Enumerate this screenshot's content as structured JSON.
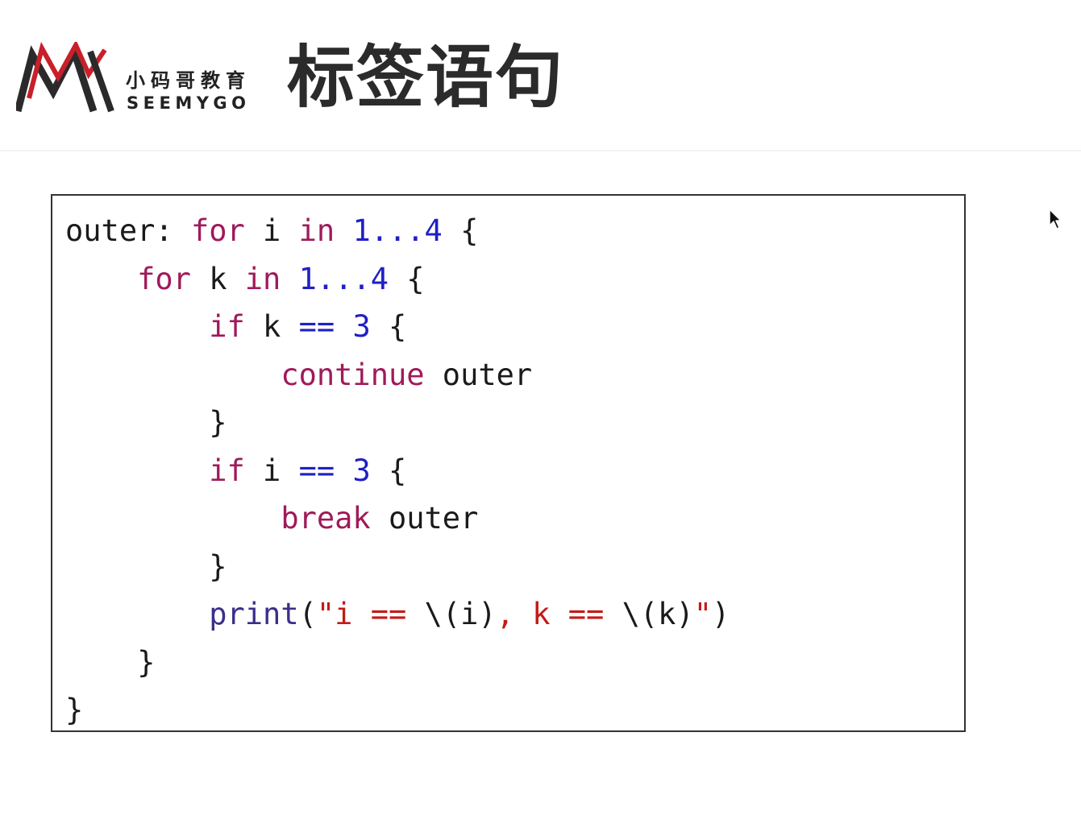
{
  "header": {
    "logo": {
      "cn_text": "小码哥教育",
      "en_text": "SEEMYGO",
      "colors": {
        "dark": "#2a2a2a",
        "red": "#c8202a"
      }
    },
    "title": "标签语句"
  },
  "code": {
    "lines": [
      [
        {
          "t": "outer: ",
          "c": "plain"
        },
        {
          "t": "for",
          "c": "kw"
        },
        {
          "t": " i ",
          "c": "plain"
        },
        {
          "t": "in",
          "c": "kw"
        },
        {
          "t": " ",
          "c": "plain"
        },
        {
          "t": "1...4",
          "c": "num"
        },
        {
          "t": " {",
          "c": "plain"
        }
      ],
      [
        {
          "t": "    ",
          "c": "plain"
        },
        {
          "t": "for",
          "c": "kw"
        },
        {
          "t": " k ",
          "c": "plain"
        },
        {
          "t": "in",
          "c": "kw"
        },
        {
          "t": " ",
          "c": "plain"
        },
        {
          "t": "1...4",
          "c": "num"
        },
        {
          "t": " {",
          "c": "plain"
        }
      ],
      [
        {
          "t": "        ",
          "c": "plain"
        },
        {
          "t": "if",
          "c": "kw"
        },
        {
          "t": " k ",
          "c": "plain"
        },
        {
          "t": "==",
          "c": "op"
        },
        {
          "t": " ",
          "c": "plain"
        },
        {
          "t": "3",
          "c": "num"
        },
        {
          "t": " {",
          "c": "plain"
        }
      ],
      [
        {
          "t": "            ",
          "c": "plain"
        },
        {
          "t": "continue",
          "c": "kw"
        },
        {
          "t": " outer",
          "c": "plain"
        }
      ],
      [
        {
          "t": "        }",
          "c": "plain"
        }
      ],
      [
        {
          "t": "        ",
          "c": "plain"
        },
        {
          "t": "if",
          "c": "kw"
        },
        {
          "t": " i ",
          "c": "plain"
        },
        {
          "t": "==",
          "c": "op"
        },
        {
          "t": " ",
          "c": "plain"
        },
        {
          "t": "3",
          "c": "num"
        },
        {
          "t": " {",
          "c": "plain"
        }
      ],
      [
        {
          "t": "            ",
          "c": "plain"
        },
        {
          "t": "break",
          "c": "kw"
        },
        {
          "t": " outer",
          "c": "plain"
        }
      ],
      [
        {
          "t": "        }",
          "c": "plain"
        }
      ],
      [
        {
          "t": "        ",
          "c": "plain"
        },
        {
          "t": "print",
          "c": "fn"
        },
        {
          "t": "(",
          "c": "plain"
        },
        {
          "t": "\"i == ",
          "c": "str"
        },
        {
          "t": "\\(",
          "c": "plain"
        },
        {
          "t": "i",
          "c": "plain"
        },
        {
          "t": ")",
          "c": "plain"
        },
        {
          "t": ", k == ",
          "c": "str"
        },
        {
          "t": "\\(",
          "c": "plain"
        },
        {
          "t": "k",
          "c": "plain"
        },
        {
          "t": ")",
          "c": "plain"
        },
        {
          "t": "\"",
          "c": "str"
        },
        {
          "t": ")",
          "c": "plain"
        }
      ],
      [
        {
          "t": "    }",
          "c": "plain"
        }
      ],
      [
        {
          "t": "}",
          "c": "plain"
        }
      ]
    ],
    "colors": {
      "kw": "#a01a5a",
      "num": "#1f1fc8",
      "op": "#1f1fc8",
      "str": "#c41a16",
      "fn": "#3a2f8a",
      "plain": "#1a1a1a"
    }
  },
  "cursor": {
    "icon": "mouse-pointer-icon"
  }
}
